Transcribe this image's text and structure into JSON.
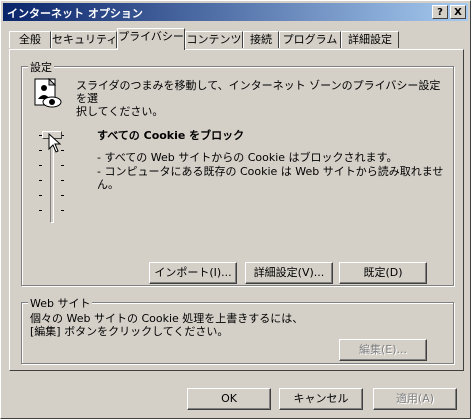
{
  "window": {
    "title": "インターネット オプション",
    "help_btn": "?",
    "close_btn": "X"
  },
  "tabs": [
    {
      "label": "全般"
    },
    {
      "label": "セキュリティ"
    },
    {
      "label": "プライバシー",
      "active": true
    },
    {
      "label": "コンテンツ"
    },
    {
      "label": "接続"
    },
    {
      "label": "プログラム"
    },
    {
      "label": "詳細設定"
    }
  ],
  "settings": {
    "group_label": "設定",
    "description": "スライダのつまみを移動して、インターネット ゾーンのプライバシー設定を選\n択してください。",
    "slider_level": "すべての Cookie をブロック",
    "detail_1": "- すべての Web サイトからの Cookie はブロックされます。",
    "detail_2": "- コンピュータにある既存の Cookie は Web サイトから読み取れませ\nん。",
    "import_btn": "インポート(I)...",
    "advanced_btn": "詳細設定(V)...",
    "default_btn": "既定(D)",
    "slider_position": "top"
  },
  "web": {
    "group_label": "Web サイト",
    "description": "個々の Web サイトの Cookie 処理を上書きするには、\n[編集] ボタンをクリックしてください。",
    "edit_btn": "編集(E)..."
  },
  "footer": {
    "ok": "OK",
    "cancel": "キャンセル",
    "apply": "適用(A)"
  }
}
